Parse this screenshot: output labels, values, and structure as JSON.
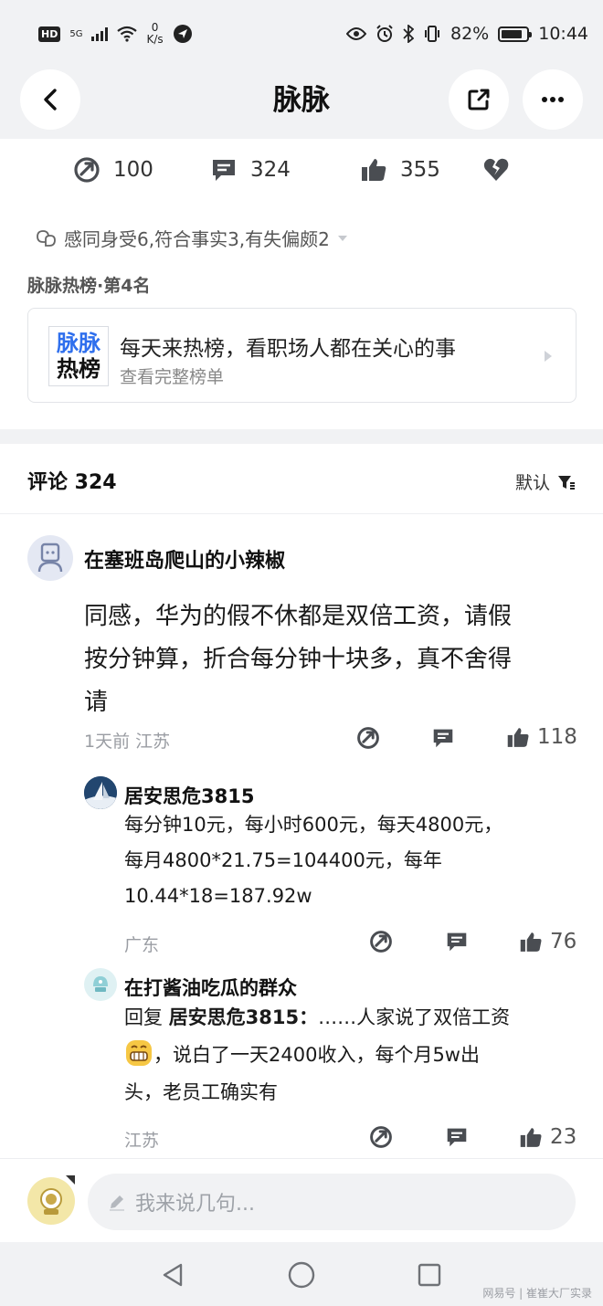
{
  "status_bar": {
    "hd": "HD",
    "signal_label": "5G",
    "net_speed_value": "0",
    "net_speed_unit": "K/s",
    "battery": "82%",
    "battery_level": 0.82,
    "time": "10:44"
  },
  "nav": {
    "title": "脉脉"
  },
  "stats": {
    "shares": "100",
    "comments": "324",
    "likes": "355"
  },
  "reaction_summary": "感同身受6,符合事实3,有失偏颇2",
  "hot_rank": {
    "label": "脉脉热榜·第4名",
    "logo_line1": "脉脉",
    "logo_line2": "热榜",
    "title": "每天来热榜，看职场人都在关心的事",
    "subtitle": "查看完整榜单"
  },
  "comments_header": {
    "title": "评论 324",
    "sort": "默认"
  },
  "comments": [
    {
      "author": "在塞班岛爬山的小辣椒",
      "body_lines": [
        "同感，华为的假不休都是双倍工资，请假",
        "按分钟算，折合每分钟十块多，真不舍得",
        "请"
      ],
      "meta": "1天前  江苏",
      "likes": "118"
    },
    {
      "author": "居安思危3815",
      "body_lines": [
        "每分钟10元，每小时600元，每天4800元，",
        "每月4800*21.75=104400元，每年",
        "10.44*18=187.92w"
      ],
      "meta": "广东",
      "likes": "76"
    },
    {
      "author": "在打酱油吃瓜的群众",
      "reply_prefix": "回复",
      "reply_to": "居安思危3815：",
      "body_line1_rest": "……人家说了双倍工资",
      "body_line2": "，说白了一天2400收入，每个月5w出",
      "body_line3": "头，老员工确实有",
      "meta": "江苏",
      "likes": "23"
    }
  ],
  "input": {
    "placeholder": "我来说几句..."
  },
  "watermark": "网易号 | 崔崔大厂实录",
  "icons": {
    "accent": "#2f6fed",
    "icon_color": "#4a4d52"
  }
}
